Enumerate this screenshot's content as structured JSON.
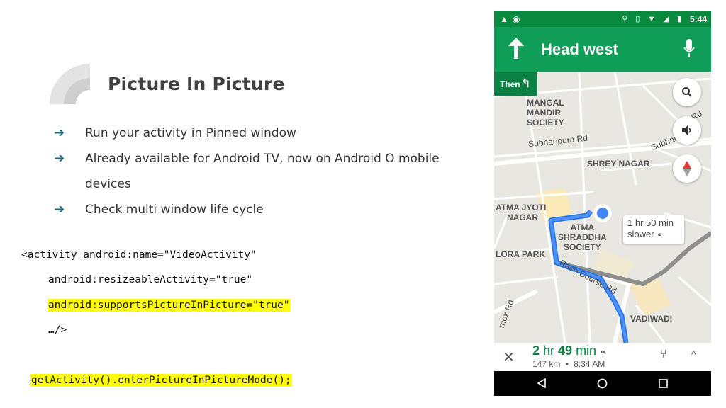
{
  "slide": {
    "title": "Picture In Picture",
    "bullets": [
      {
        "arrow": "➔",
        "text": "Run your activity in Pinned window"
      },
      {
        "arrow": "➔",
        "text": "Already available for Android TV, now on Android O mobile"
      },
      {
        "arrow": "",
        "text": "devices"
      },
      {
        "arrow": "➔",
        "text": "Check multi window life cycle"
      }
    ],
    "code": {
      "line1": "<activity android:name=\"VideoActivity\"",
      "line2": "android:resizeableActivity=\"true\"",
      "line3": "android:supportsPictureInPicture=\"true\"",
      "line4": "…/>",
      "line5": "getActivity().enterPictureInPictureMode();"
    },
    "highlight_color": "#ffff00"
  },
  "phone": {
    "status_bar": {
      "time": "5:44",
      "icons": "location-icon vibrate-icon wifi-icon signal-icon battery-icon"
    },
    "nav": {
      "instruction": "Head west",
      "then_label": "Then",
      "then_icon": "↰"
    },
    "map_labels": {
      "mangal": [
        "MANGAL",
        "MANDIR",
        "SOCIETY"
      ],
      "subhanpura": "Subhanpura Rd",
      "subhan2": "Subhan",
      "rd": "Rd",
      "shrey": "SHREY NAGAR",
      "atma_jyoti": [
        "ATMA JYOTI",
        "NAGAR"
      ],
      "atma_shraddha": [
        "ATMA",
        "SHRADDHA",
        "SOCIETY"
      ],
      "lora": "LORA PARK",
      "race_course": "Race Course Rd",
      "vadiwadi": "VADIWADI",
      "mox": "mox Rd"
    },
    "traffic": {
      "line1": "1 hr 50 min",
      "line2": "slower"
    },
    "bottom": {
      "close": "✕",
      "hr": "2",
      "hr_unit": " hr ",
      "min": "49",
      "min_unit": " min",
      "distance": "147 km",
      "dot": "•",
      "arrival": "8:34 AM",
      "alt_icon": "⑂",
      "caret": "^"
    },
    "colors": {
      "green_header": "#0f9d58",
      "route_blue": "#4285f4",
      "traffic_gray": "#8e8e8e"
    }
  }
}
